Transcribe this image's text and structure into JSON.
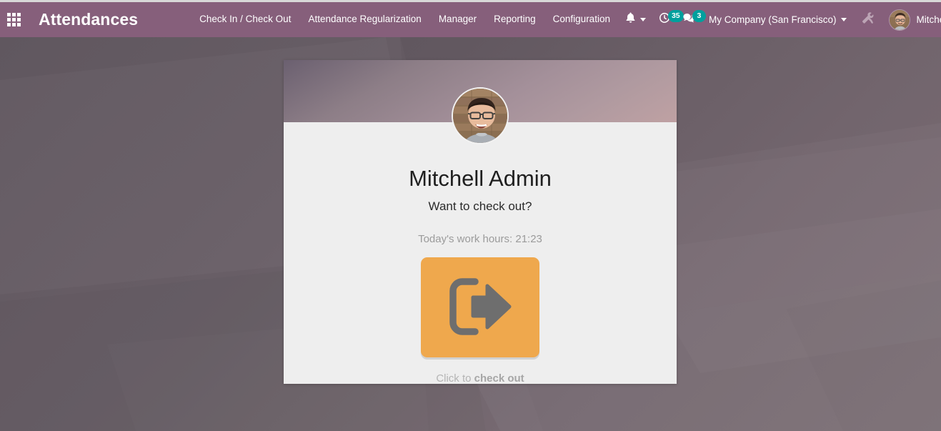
{
  "navbar": {
    "apps_icon": "apps-grid-icon",
    "app_title": "Attendances",
    "menus": [
      {
        "label": "Check In / Check Out",
        "name": "menu-check-in-check-out"
      },
      {
        "label": "Attendance Regularization",
        "name": "menu-attendance-regularization"
      },
      {
        "label": "Manager",
        "name": "menu-manager"
      },
      {
        "label": "Reporting",
        "name": "menu-reporting"
      },
      {
        "label": "Configuration",
        "name": "menu-configuration"
      }
    ],
    "systray": {
      "bell_icon": "bell-icon",
      "activity_icon": "clock-activity-icon",
      "activity_count": "35",
      "messaging_icon": "messages-icon",
      "messaging_count": "3",
      "company": "My Company (San Francisco)",
      "debug_icon": "debug-tools-icon",
      "user_name": "Mitchell Admin",
      "user_avatar": "user-avatar"
    }
  },
  "card": {
    "employee_avatar": "employee-avatar",
    "employee_name": "Mitchell Admin",
    "prompt": "Want to check out?",
    "work_hours": "Today's work hours: 21:23",
    "button_icon": "sign-out-icon",
    "hint_prefix": "Click to ",
    "hint_action": "check out"
  },
  "colors": {
    "navbar": "#865f7b",
    "badge": "#00a09d",
    "button": "#efa84d",
    "card_body": "#eeeeee",
    "desktop": "#6b5f68"
  }
}
